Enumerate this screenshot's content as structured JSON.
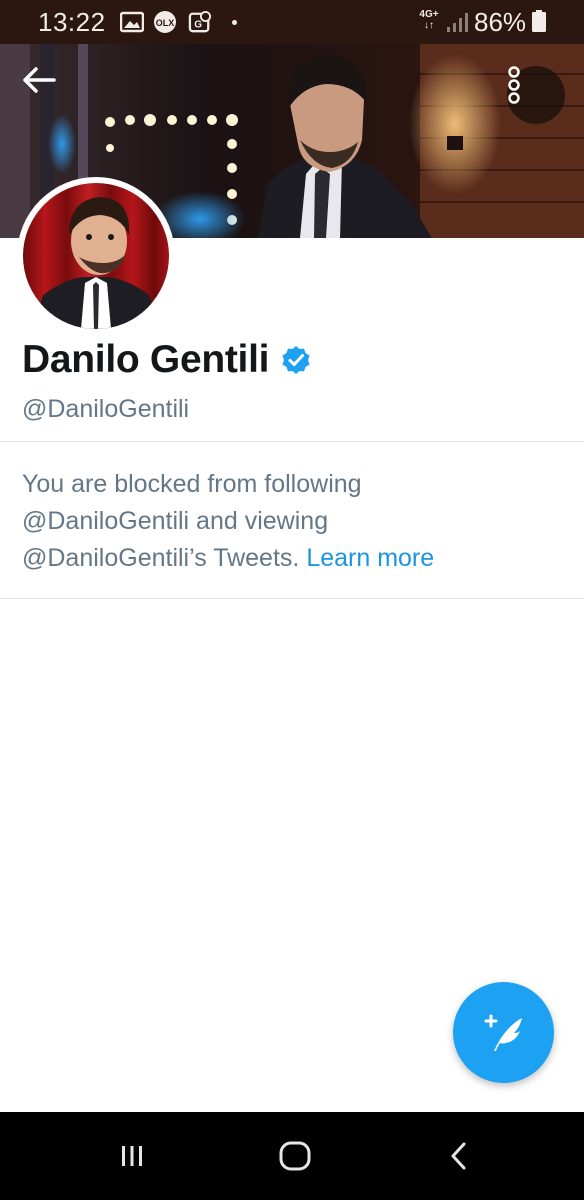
{
  "status_bar": {
    "time": "13:22",
    "network": [
      "4G+",
      "↓↑"
    ],
    "battery_percent": "86%",
    "icons": [
      "gallery-icon",
      "olx-icon",
      "location-app-icon",
      "notification-dot-icon",
      "signal-icon",
      "battery-icon"
    ]
  },
  "header": {
    "back_icon": "back-arrow-icon",
    "menu_icon": "more-vertical-icon"
  },
  "profile": {
    "display_name": "Danilo Gentili",
    "verified": true,
    "handle": "@DaniloGentili"
  },
  "blocked_notice": {
    "line1": "You are blocked from following",
    "line2": "@DaniloGentili and viewing",
    "line3": "@DaniloGentili’s Tweets.",
    "link": "Learn more"
  },
  "compose_fab": {
    "icon": "compose-tweet-icon"
  },
  "nav_bar": {
    "icons": [
      "recent-apps-icon",
      "home-icon",
      "back-icon"
    ]
  },
  "colors": {
    "status_bar_bg": "#2b1710",
    "twitter_blue": "#1da1f2",
    "link_blue": "#1b95e0",
    "secondary_text": "#657786",
    "divider": "#e1e8ed"
  }
}
